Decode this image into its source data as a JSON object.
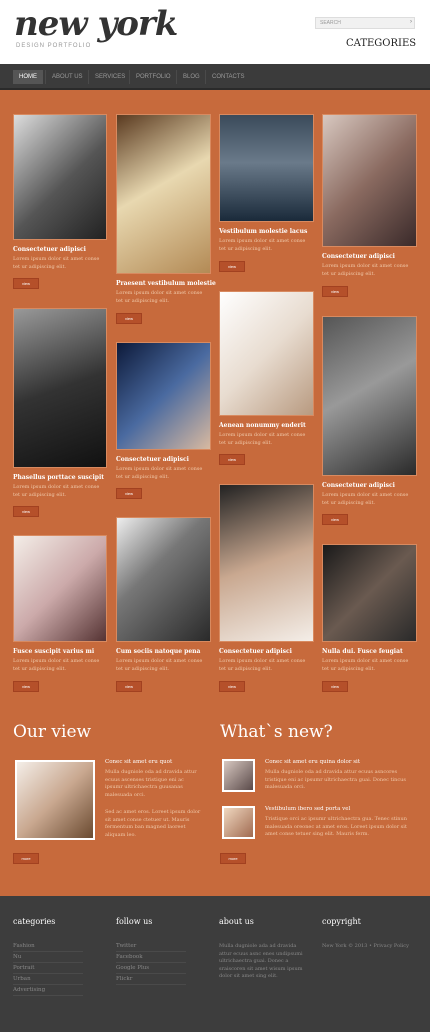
{
  "header": {
    "logo": "new york",
    "logo_subtitle": "DESIGN PORTFOLIO",
    "search_placeholder": "SEARCH",
    "categories_title": "CATEGORIES"
  },
  "nav": [
    "HOME",
    "ABOUT US",
    "SERVICES",
    "PORTFOLIO",
    "BLOG",
    "CONTACTS"
  ],
  "grid": {
    "button_label": "view",
    "items": [
      {
        "title": "Consectetuer adipisci",
        "desc": "Lorem ipsum dolor sit amet conse tet ur adipiscing elit."
      },
      {
        "title": "Praesent vestibulum molestie",
        "desc": "Lorem ipsum dolor sit amet conse tet ur adipiscing elit."
      },
      {
        "title": "Vestibulum molestie lacus",
        "desc": "Lorem ipsum dolor sit amet conse tet ur adipiscing elit."
      },
      {
        "title": "Consectetuer adipisci",
        "desc": "Lorem ipsum dolor sit amet conse tet ur adipiscing elit."
      },
      {
        "title": "Phasellus porttace suscipit",
        "desc": "Lorem ipsum dolor sit amet conse tet ur adipiscing elit."
      },
      {
        "title": "Consectetuer adipisci",
        "desc": "Lorem ipsum dolor sit amet conse tet ur adipiscing elit."
      },
      {
        "title": "Aenean nonummy enderit",
        "desc": "Lorem ipsum dolor sit amet conse tet ur adipiscing elit."
      },
      {
        "title": "Consectetuer adipisci",
        "desc": "Lorem ipsum dolor sit amet conse tet ur adipiscing elit."
      },
      {
        "title": "Fusce suscipit varius mi",
        "desc": "Lorem ipsum dolor sit amet conse tet ur adipiscing elit."
      },
      {
        "title": "Cum sociis natoque pena",
        "desc": "Lorem ipsum dolor sit amet conse tet ur adipiscing elit."
      },
      {
        "title": "Consectetuer adipisci",
        "desc": "Lorem ipsum dolor sit amet conse tet ur adipiscing elit."
      },
      {
        "title": "Nulla dui. Fusce feugiat",
        "desc": "Lorem ipsum dolor sit amet conse tet ur adipiscing elit."
      }
    ]
  },
  "our_view": {
    "title": "Our view",
    "heading": "Conec sit amet eru quot",
    "para1": "Mulla dugniole oda ad dravida attur ecuus ascenses tristique eni ac ipsumr ultrichaectra guusanas malesuada orci.",
    "para2": "Sed ac amet eros. Loreet ipsum dolor sit amet conse ctetuer ut. Mauris fermentum ban magned laoreet aliquam leo.",
    "button": "more"
  },
  "whats_new": {
    "title": "What`s new?",
    "item1_title": "Conec sit amet eru quina dolor sit",
    "item1_text": "Mulla dugniole oda ad dravida attur ecuus asncores tristique eni ac ipsumr ultrichaectra guai. Donec tincus malesuada orci.",
    "item2_title": "Vestibulum ibero sed porta vel",
    "item2_text": "Tristique orci ac ipsumr ultrichaectra gua. Tenec stinun malesuada oreonec at amet eros. Loreet ipsum dolor sit amet conse tetuer sing elit. Mauris ferm.",
    "button": "more"
  },
  "footer": {
    "categories_head": "categories",
    "categories": [
      "Fashion",
      "Nu",
      "Portrait",
      "Urban",
      "Advertising"
    ],
    "follow_head": "follow us",
    "follow": [
      "Twitter",
      "Facebook",
      "Google Plus",
      "Flickr"
    ],
    "about_head": "about us",
    "about_text": "Mulla dugniole ada ad dravida attur ecuus asnc enes undipsumi ultrichaectra guai. Donec a sraiscoren sit amet wisum ipsum dolor sit amet sing elit.",
    "copyright_head": "copyright",
    "copyright_text": "New York © 2013 • Privacy Policy"
  }
}
